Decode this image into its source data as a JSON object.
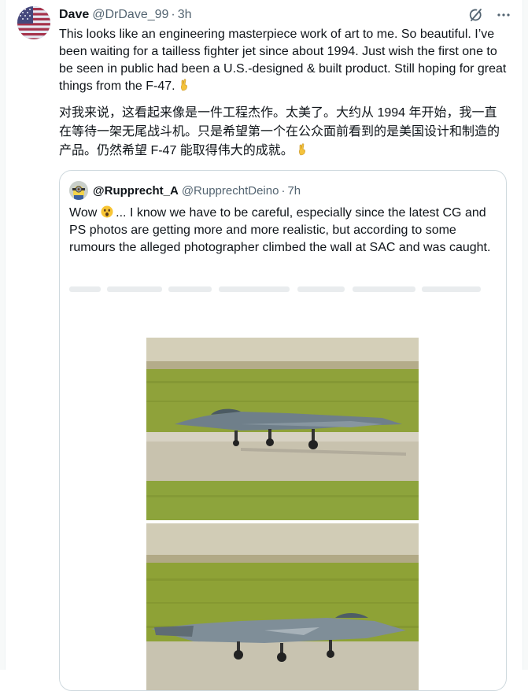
{
  "tweet": {
    "author_name": "Dave",
    "author_handle": "@DrDave_99",
    "separator": "·",
    "time": "3h",
    "text_en": "This looks like an engineering masterpiece work of art to me. So beautiful. I’ve been waiting for a tailless fighter jet since about 1994. Just wish the first one to be seen in public had been a U.S.-designed & built product. Still hoping for great things from the F-47.",
    "text_zh": "对我来说，这看起来像是一件工程杰作。太美了。大约从 1994 年开始，我一直在等待一架无尾战斗机。只是希望第一个在公众面前看到的是美国设计和制造的产品。仍然希望 F-47 能取得伟大的成就。"
  },
  "icons": {
    "avatar": "us-flag-avatar",
    "grok": "grok-icon",
    "more": "more-icon",
    "emoji_hand": "crossed-fingers-emoji",
    "emoji_face": "astonished-face-emoji"
  },
  "quote": {
    "author_name": "@Rupprecht_A",
    "author_handle": "@RupprechtDeino",
    "separator": "·",
    "time": "7h",
    "text_before_emoji": "Wow",
    "text_after_emoji": " ... I know we have to be careful, especially since the latest CG and PS photos are getting more and more realistic, but according to some rumours the alleged photographer climbed the wall at SAC and was caught."
  },
  "colors": {
    "text": "#0f1419",
    "secondary": "#536471",
    "border": "#cfd9de",
    "grass": "#8ea236",
    "runway": "#c9c3ae"
  }
}
